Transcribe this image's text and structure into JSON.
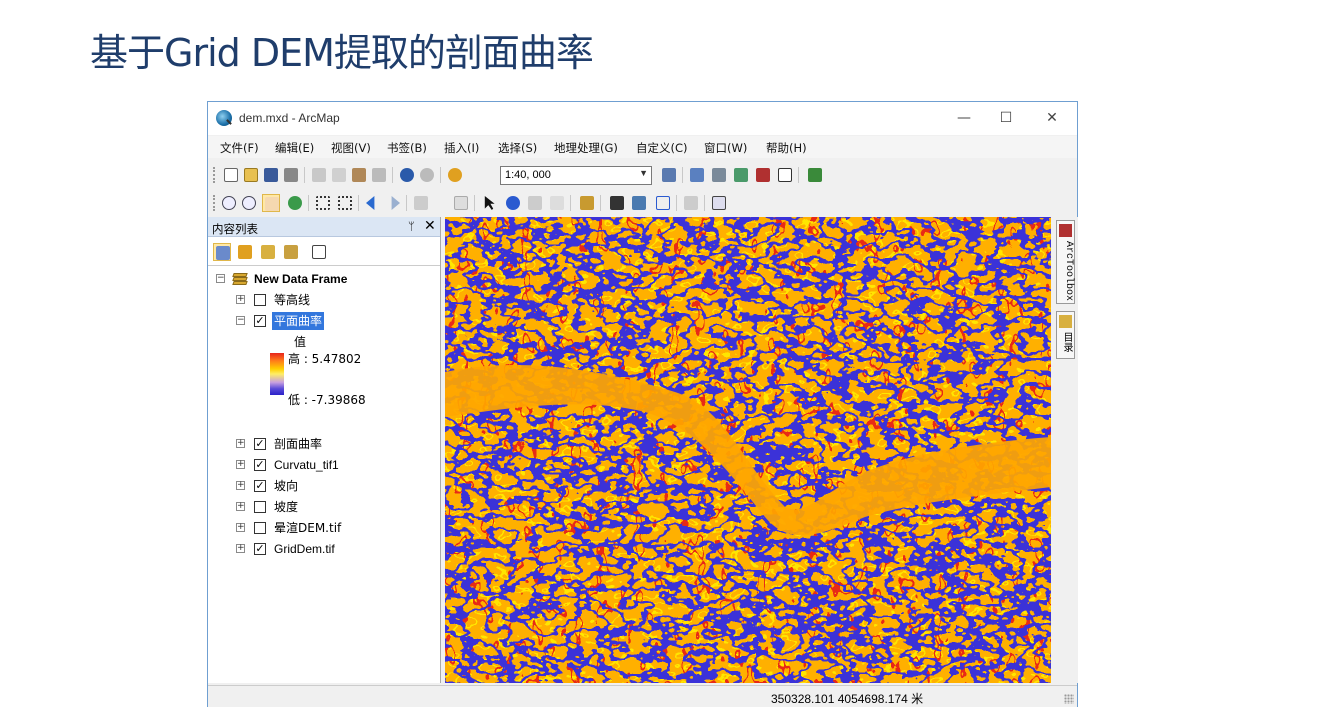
{
  "slide": {
    "title": "基于Grid DEM提取的剖面曲率"
  },
  "window": {
    "title": "dem.mxd - ArcMap",
    "minimize": "—",
    "maximize": "☐",
    "close": "✕"
  },
  "menu": [
    "文件(F)",
    "编辑(E)",
    "视图(V)",
    "书签(B)",
    "插入(I)",
    "选择(S)",
    "地理处理(G)",
    "自定义(C)",
    "窗口(W)",
    "帮助(H)"
  ],
  "toolbar": {
    "scale": "1:40, 000"
  },
  "toc": {
    "title": "内容列表",
    "pin": "ᛘ",
    "close": "✕",
    "data_frame": "New Data Frame",
    "layers": [
      {
        "name": "等高线",
        "checked": false,
        "expanded": false
      },
      {
        "name": "平面曲率",
        "checked": true,
        "expanded": true,
        "selected": true
      },
      {
        "name": "剖面曲率",
        "checked": true,
        "expanded": false
      },
      {
        "name": "Curvatu_tif1",
        "checked": true,
        "expanded": false
      },
      {
        "name": "坡向",
        "checked": true,
        "expanded": false
      },
      {
        "name": "坡度",
        "checked": false,
        "expanded": false
      },
      {
        "name": "晕渲DEM.tif",
        "checked": false,
        "expanded": false
      },
      {
        "name": "GridDem.tif",
        "checked": true,
        "expanded": false
      }
    ],
    "legend": {
      "field": "值",
      "high": "高 : 5.47802",
      "low": "低 : -7.39868"
    }
  },
  "right_dock": {
    "arctoolbox": "ArcToolbox",
    "catalog": "目录"
  },
  "status": {
    "coordinates": "350328.101  4054698.174 米"
  },
  "colors": {
    "title": "#1f3d6b",
    "ramp_high": "#e8241c",
    "ramp_mid": "#ffd000",
    "ramp_low": "#2a20c8",
    "selection": "#3377dd"
  }
}
